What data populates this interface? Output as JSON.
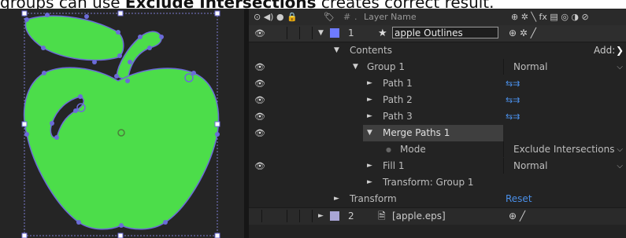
{
  "caption": {
    "text_before": "groups can use ",
    "bold": "Exclude Intersections",
    "text_after": " creates correct result."
  },
  "header": {
    "icons": "⊙ ◀) ● 🔒",
    "label_icon": "🏷",
    "hash": "#",
    "dot": ".",
    "layer_name": "Layer Name",
    "switches": "⊕ ✲ ╲ fx ▤ ◎ ◑ ⊘"
  },
  "colors": {
    "apple_fill": "#4cdd4a",
    "layer_blue": "#6e7bff",
    "layer_lavender": "#a9a5d6",
    "link_blue": "#4a8fe8",
    "selected": "#3f3f3f"
  },
  "layers": [
    {
      "num": "1",
      "name": "apple Outlines",
      "switches": "⊕ ✲ ╱"
    },
    {
      "num": "2",
      "name": "[apple.eps]",
      "switches": "⊕    ╱"
    }
  ],
  "contents": {
    "label": "Contents",
    "add_label": "Add:",
    "add_icon": "❯"
  },
  "group": {
    "name": "Group 1",
    "blend": "Normal"
  },
  "paths": [
    "Path 1",
    "Path 2",
    "Path 3"
  ],
  "merge": {
    "name": "Merge Paths 1",
    "mode_label": "Mode",
    "mode_value": "Exclude Intersections"
  },
  "fill": {
    "name": "Fill 1",
    "blend": "Normal"
  },
  "transform_group": "Transform: Group 1",
  "transform": {
    "label": "Transform",
    "reset": "Reset"
  }
}
